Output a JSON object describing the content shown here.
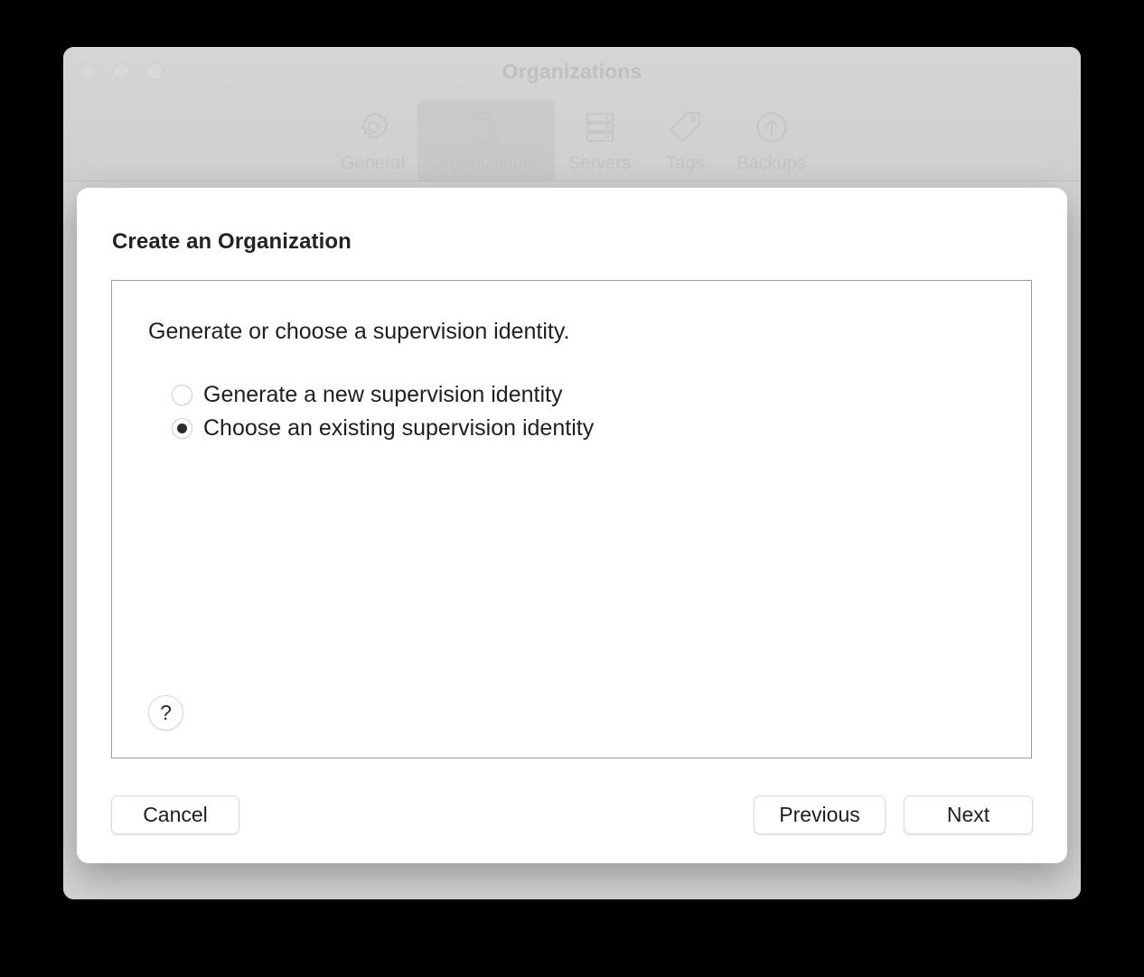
{
  "window": {
    "title": "Organizations",
    "traffic_lights": [
      "close",
      "minimize",
      "zoom"
    ],
    "toolbar": {
      "items": [
        {
          "label": "General",
          "icon": "gear-icon",
          "selected": false
        },
        {
          "label": "Organizations",
          "icon": "building-icon",
          "selected": true
        },
        {
          "label": "Servers",
          "icon": "server-rack-icon",
          "selected": false
        },
        {
          "label": "Tags",
          "icon": "tag-icon",
          "selected": false
        },
        {
          "label": "Backups",
          "icon": "upload-circle-icon",
          "selected": false
        }
      ]
    }
  },
  "sheet": {
    "title": "Create an Organization",
    "prompt": "Generate or choose a supervision identity.",
    "options": [
      {
        "label": "Generate a new supervision identity",
        "selected": false
      },
      {
        "label": "Choose an existing supervision identity",
        "selected": true
      }
    ],
    "help_glyph": "?",
    "buttons": {
      "cancel": "Cancel",
      "previous": "Previous",
      "next": "Next"
    }
  },
  "colors": {
    "page_background": "#000000",
    "window_background": "#d2d2d2",
    "sheet_background": "#ffffff",
    "title_text": "#c0c0c0",
    "body_text": "#1f1f1f",
    "box_border": "#9a9a9a",
    "radio_dot": "#2b2b2b"
  }
}
